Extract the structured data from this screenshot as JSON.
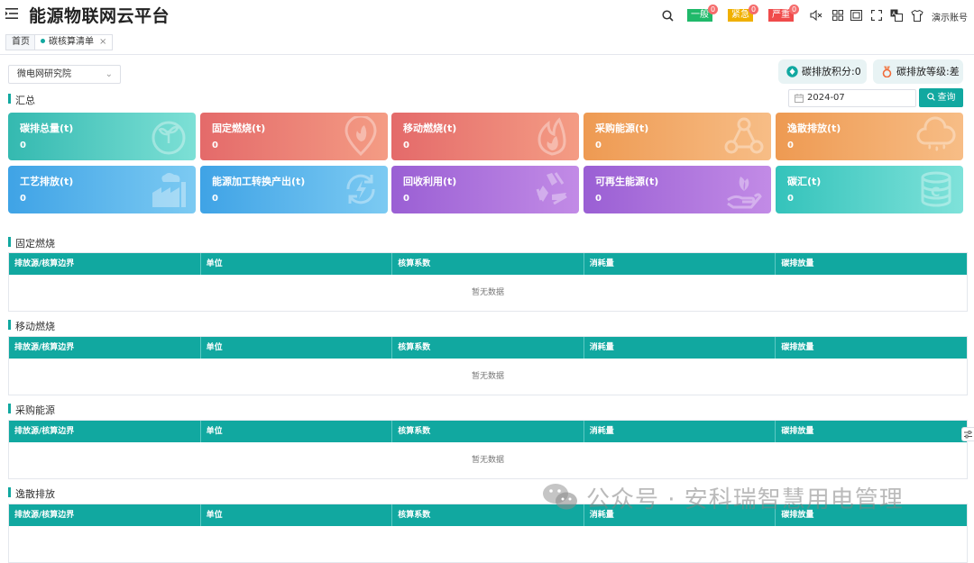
{
  "header": {
    "app_title": "能源物联网云平台",
    "alerts": [
      {
        "label": "一般",
        "count": "0",
        "color": "#20b96a"
      },
      {
        "label": "紧急",
        "count": "0",
        "color": "#f0b000"
      },
      {
        "label": "严重",
        "count": "0",
        "color": "#f04b4b"
      }
    ],
    "account_label": "演示账号",
    "icons": [
      "search-icon",
      "mute-icon",
      "grid-icon",
      "screen-icon",
      "fullscreen-icon",
      "language-icon",
      "theme-shirt-icon"
    ]
  },
  "tabs": [
    {
      "label": "首页",
      "active": false
    },
    {
      "label": "碳核算清单",
      "active": true,
      "close": "×"
    }
  ],
  "toolbar": {
    "org_select_value": "微电网研究院",
    "score_label": "碳排放积分:0",
    "level_label": "碳排放等级:差",
    "date_value": "2024-07",
    "query_label": "查询"
  },
  "summary": {
    "title": "汇总",
    "cards": [
      {
        "title": "碳排总量(t)",
        "value": "0",
        "icon": "carbon-total-icon",
        "color_from": "#34b9b0",
        "color_to": "#7de0d6"
      },
      {
        "title": "固定燃烧(t)",
        "value": "0",
        "icon": "fire-location-icon",
        "color_from": "#e46a6a",
        "color_to": "#f49c84"
      },
      {
        "title": "移动燃烧(t)",
        "value": "0",
        "icon": "flame-icon",
        "color_from": "#e46a6a",
        "color_to": "#f49c84"
      },
      {
        "title": "采购能源(t)",
        "value": "0",
        "icon": "network-icon",
        "color_from": "#ee9a52",
        "color_to": "#f7bd86"
      },
      {
        "title": "逸散排放(t)",
        "value": "0",
        "icon": "cloud-icon",
        "color_from": "#ee9a52",
        "color_to": "#f7bd86"
      },
      {
        "title": "工艺排放(t)",
        "value": "0",
        "icon": "factory-icon",
        "color_from": "#3fa3e6",
        "color_to": "#7ccaf2"
      },
      {
        "title": "能源加工转换产出(t)",
        "value": "0",
        "icon": "energy-cycle-icon",
        "color_from": "#3fa3e6",
        "color_to": "#7ccaf2"
      },
      {
        "title": "回收利用(t)",
        "value": "0",
        "icon": "recycle-icon",
        "color_from": "#9a5fd4",
        "color_to": "#c28be6"
      },
      {
        "title": "可再生能源(t)",
        "value": "0",
        "icon": "hand-leaf-icon",
        "color_from": "#9a5fd4",
        "color_to": "#c28be6"
      },
      {
        "title": "碳汇(t)",
        "value": "0",
        "icon": "carbon-sink-icon",
        "color_from": "#34c3bb",
        "color_to": "#7fe2da"
      }
    ]
  },
  "table_headers": [
    "排放源/核算边界",
    "单位",
    "核算系数",
    "消耗量",
    "碳排放量"
  ],
  "sections": [
    {
      "title": "固定燃烧",
      "empty_text": "暂无数据"
    },
    {
      "title": "移动燃烧",
      "empty_text": "暂无数据"
    },
    {
      "title": "采购能源",
      "empty_text": "暂无数据"
    },
    {
      "title": "逸散排放",
      "empty_text": ""
    }
  ],
  "watermark": "公众号 · 安科瑞智慧用电管理"
}
